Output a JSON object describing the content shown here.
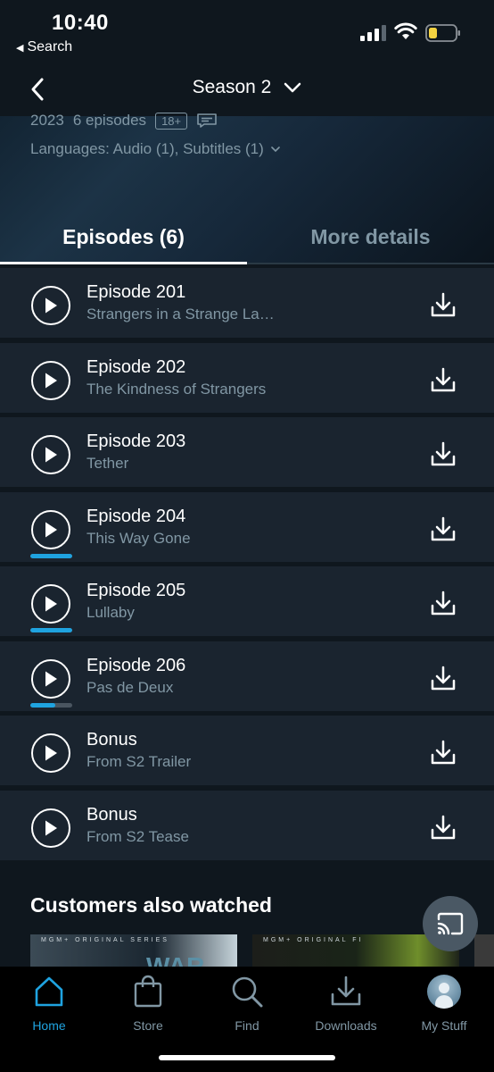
{
  "status_bar": {
    "time": "10:40",
    "back_app_label": "Search"
  },
  "nav": {
    "title": "Season 2"
  },
  "meta": {
    "year": "2023",
    "episodes_count": "6 episodes",
    "rating": "18+",
    "languages": "Languages: Audio (1), Subtitles (1)"
  },
  "tabs": {
    "episodes": "Episodes (6)",
    "more_details": "More details"
  },
  "episodes": [
    {
      "title": "Episode 201",
      "subtitle": "Strangers in a Strange La…",
      "progress": null
    },
    {
      "title": "Episode 202",
      "subtitle": "The Kindness of Strangers",
      "progress": null
    },
    {
      "title": "Episode 203",
      "subtitle": "Tether",
      "progress": null
    },
    {
      "title": "Episode 204",
      "subtitle": "This Way Gone",
      "progress": 1.0
    },
    {
      "title": "Episode 205",
      "subtitle": "Lullaby",
      "progress": 1.0
    },
    {
      "title": "Episode 206",
      "subtitle": "Pas de Deux",
      "progress": 0.6
    },
    {
      "title": "Bonus",
      "subtitle": "From S2 Trailer",
      "progress": null
    },
    {
      "title": "Bonus",
      "subtitle": "From S2 Tease",
      "progress": null
    }
  ],
  "customers_also_watched": {
    "title": "Customers also watched",
    "thumb1_tag": "MGM+ ORIGINAL SERIES",
    "thumb1_text": "WAR",
    "thumb2_tag": "MGM+ ORIGINAL FI"
  },
  "bottom_nav": {
    "items": [
      {
        "label": "Home",
        "icon": "home-icon",
        "active": true
      },
      {
        "label": "Store",
        "icon": "shopping-bag-icon",
        "active": false
      },
      {
        "label": "Find",
        "icon": "search-icon",
        "active": false
      },
      {
        "label": "Downloads",
        "icon": "download-icon",
        "active": false
      },
      {
        "label": "My Stuff",
        "icon": "avatar",
        "active": false
      }
    ]
  },
  "colors": {
    "background": "#0f171e",
    "row_bg": "#1a242f",
    "muted_text": "#8197a4",
    "accent": "#1fa3e0",
    "battery_low": "#f5d341"
  }
}
